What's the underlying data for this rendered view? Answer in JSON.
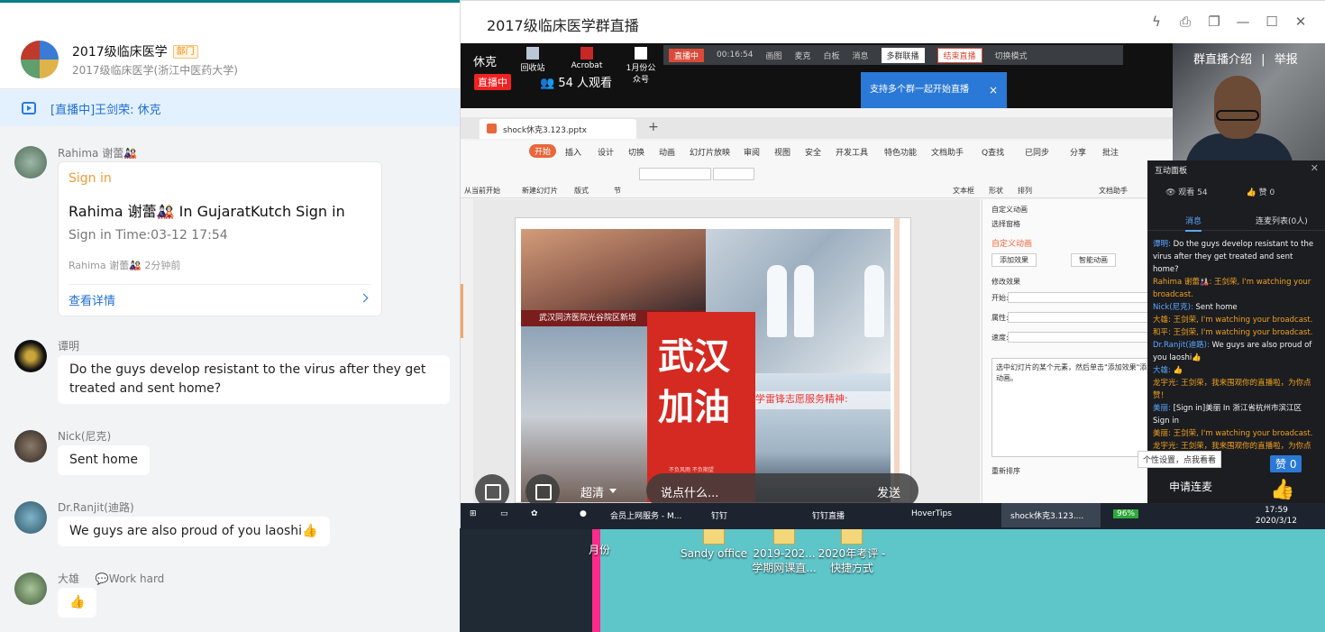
{
  "chat": {
    "group_title": "2017级临床医学",
    "group_badge": "部门",
    "group_sub": "2017级临床医学(浙江中医药大学)",
    "live_banner": "[直播中]王剑荣: 休克",
    "card": {
      "sender": "Rahima 谢蕾🎎",
      "top": "Sign in",
      "title": "Rahima 谢蕾🎎 In GujaratKutch Sign in",
      "time": "Sign in Time:03-12 17:54",
      "meta": "Rahima 谢蕾🎎 2分钟前",
      "link": "查看详情"
    },
    "messages": [
      {
        "sender": "谭明",
        "text": "Do the guys develop resistant to the virus after they get treated and sent home?"
      },
      {
        "sender": "Nick(尼克)",
        "text": "Sent home"
      },
      {
        "sender": "Dr.Ranjit(迪路)",
        "text": "We guys are also proud of you laoshi👍"
      },
      {
        "sender": "大雄",
        "extra": "💬Work hard",
        "text": "👍"
      }
    ]
  },
  "live": {
    "window_title": "2017级临床医学群直播",
    "presenter": "休克",
    "live_tag": "直播中",
    "viewers": "54 人观看",
    "intro_link": "群直播介绍",
    "report_link": "举报",
    "share_bar": {
      "live": "直播中",
      "time": "00:16:54",
      "items": [
        "画图",
        "麦克",
        "白板",
        "消息"
      ],
      "multi": "多群联播",
      "end": "结束直播",
      "mode": "切换模式"
    },
    "tooltip": "支持多个群一起开始直播",
    "desktop_mini": [
      "回收站",
      "Acrobat",
      "1月份公众号"
    ],
    "wps": {
      "tab": "shock休克3.123.pptx",
      "menu": [
        "开始",
        "插入",
        "设计",
        "切换",
        "动画",
        "幻灯片放映",
        "审阅",
        "视图",
        "安全",
        "开发工具",
        "特色功能",
        "文档助手",
        "Q查找",
        "已同步",
        "分享",
        "批注"
      ],
      "toolbar": [
        "从当前开始",
        "新建幻灯片",
        "版式",
        "节",
        "文本框",
        "形状",
        "排列",
        "文档助手"
      ],
      "slide_caption1": "武汉同济医院光谷院区新增",
      "slide_big": "武汉加油",
      "slide_small": "不负风雨 不负期望",
      "slide_caption2": "学雷锋志愿服务精神:",
      "anim": {
        "header": "自定义动画",
        "select": "选择窗格",
        "section": "自定义动画",
        "add": "添加效果",
        "smart": "智能动画",
        "modify": "修改效果",
        "start": "开始:",
        "prop": "属性:",
        "speed": "速度:",
        "hint": "选中幻灯片的某个元素，然后单击\"添加效果\"添加动画。",
        "reorder": "重新排序"
      }
    },
    "taskbar": {
      "items": [
        "会员上网服务 - M...",
        "钉钉",
        "钉钉直播",
        "HoverTips",
        "shock休克3.123...."
      ],
      "battery": "96%",
      "time": "17:59",
      "date": "2020/3/12"
    },
    "controls": {
      "quality": "超清",
      "placeholder": "说点什么...",
      "send": "发送",
      "apply": "申请连麦",
      "likes": "赞 0"
    },
    "tip": "个性设置，点我看看",
    "interact": {
      "header": "互动面板",
      "viewers": "观看 54",
      "likes": "赞 0",
      "tab_msg": "消息",
      "tab_connect": "连麦列表(0人)",
      "feed": [
        {
          "name": "谭明:",
          "text": "Do the guys develop resistant to the virus after they get treated and sent home?",
          "color": "w"
        },
        {
          "name": "Rahima 谢蕾🎎:",
          "text": "王剑荣, I'm watching your broadcast.",
          "color": "or"
        },
        {
          "name": "Nick(尼克):",
          "text": "Sent home",
          "color": "w"
        },
        {
          "name": "大雄:",
          "text": "王剑荣, I'm watching your broadcast.",
          "color": "or"
        },
        {
          "name": "和平:",
          "text": "王剑荣, I'm watching your broadcast.",
          "color": "or"
        },
        {
          "name": "Dr.Ranjit(迪路):",
          "text": "We guys are also proud of you laoshi👍",
          "color": "w"
        },
        {
          "name": "大雄:",
          "text": "👍",
          "color": "w"
        },
        {
          "name": "龙宇光:",
          "text": "王剑荣，我来围观你的直播啦，为你点赞！",
          "color": "or"
        },
        {
          "name": "美丽:",
          "text": "[Sign in]美丽 In 浙江省杭州市滨江区 Sign in",
          "color": "w"
        },
        {
          "name": "美丽:",
          "text": "王剑荣, I'm watching your broadcast.",
          "color": "or"
        },
        {
          "name": "龙宇光:",
          "text": "王剑荣，我来围观你的直播啦，为你点赞！",
          "color": "or"
        }
      ]
    }
  },
  "desktop": {
    "icons": [
      "月份",
      "Sandy office",
      "2019-202...学期网课直...",
      "2020年考评 - 快捷方式"
    ]
  }
}
